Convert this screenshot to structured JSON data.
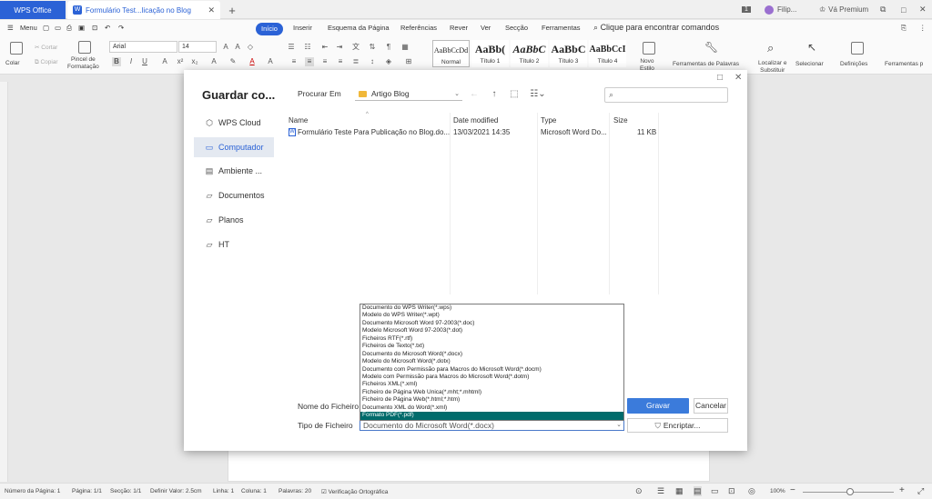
{
  "titlebar": {
    "app_tab": "WPS Office",
    "doc_tab": "Formulário Test...licação no Blog",
    "badge": "1",
    "user": "Filip...",
    "premium": "Vá Premium"
  },
  "menu": {
    "items": [
      "Menu",
      "Início",
      "Inserir",
      "Esquema da Página",
      "Referências",
      "Rever",
      "Ver",
      "Secção",
      "Ferramentas"
    ],
    "search_placeholder": "Clique para encontrar comandos"
  },
  "ribbon": {
    "cut": "Cortar",
    "copy": "Copiar",
    "paste": "Colar",
    "format_painter": "Pincel de\nFormatação",
    "font": "Arial",
    "size": "14",
    "styles": [
      {
        "preview": "AaBbCcDd",
        "label": "Normal"
      },
      {
        "preview": "AaBb(",
        "label": "Título 1"
      },
      {
        "preview": "AaBbC",
        "label": "Título 2"
      },
      {
        "preview": "AaBbC",
        "label": "Título 3"
      },
      {
        "preview": "AaBbCcI",
        "label": "Título 4"
      }
    ],
    "new_style": "Novo\nEstilo",
    "word_tools": "Ferramentas de Palavras",
    "find_replace": "Localizar e\nSubstituir",
    "select": "Selecionar",
    "settings": "Definições",
    "tools": "Ferramentas p"
  },
  "dialog": {
    "title": "Guardar co...",
    "nav": [
      "WPS Cloud",
      "Computador",
      "Ambiente ...",
      "Documentos",
      "Planos",
      "HT"
    ],
    "look_in_label": "Procurar Em",
    "look_in_value": "Artigo Blog",
    "columns": [
      "Name",
      "Date modified",
      "Type",
      "Size"
    ],
    "files": [
      {
        "name": "Formulário Teste Para Publicação no Blog.do...",
        "date": "13/03/2021 14:35",
        "type": "Microsoft Word Do...",
        "size": "11 KB"
      }
    ],
    "filename_label": "Nome do Ficheiro",
    "filetype_label": "Tipo de Ficheiro",
    "filetype_value": "Documento do Microsoft Word(*.docx)",
    "save_button": "Gravar",
    "cancel_button": "Cancelar",
    "encrypt_button": "Encriptar...",
    "dropdown_options": [
      "Documento do WPS Writer(*.wps)",
      "Modelo do WPS Writer(*.wpt)",
      "Documento Microsoft Word 97-2003(*.doc)",
      "Modelo Microsoft Word 97-2003(*.dot)",
      "Ficheiros RTF(*.rtf)",
      "Ficheiros de Texto(*.txt)",
      "Documento do Microsoft Word(*.docx)",
      "Modelo do Microsoft Word(*.dotx)",
      "Documento com Permissão para Macros do Microsoft Word(*.docm)",
      "Modelo com Permissão para Macros do Microsoft Word(*.dotm)",
      "Ficheiros XML(*.xml)",
      "Ficheiro de Página Web Única(*.mht;*.mhtml)",
      "Ficheiro de Página Web(*.html;*.htm)",
      "Documento XML do Word(*.xml)",
      "Formato PDF(*.pdf)"
    ],
    "dropdown_selected_index": 14
  },
  "status": {
    "page_number": "Número da Página: 1",
    "page": "Página: 1/1",
    "section": "Secção: 1/1",
    "set_value": "Definir Valor: 2.5cm",
    "line": "Linha: 1",
    "column": "Coluna: 1",
    "words": "Palavras: 20",
    "spell": "Verificação Ortográfica",
    "zoom": "100%"
  }
}
